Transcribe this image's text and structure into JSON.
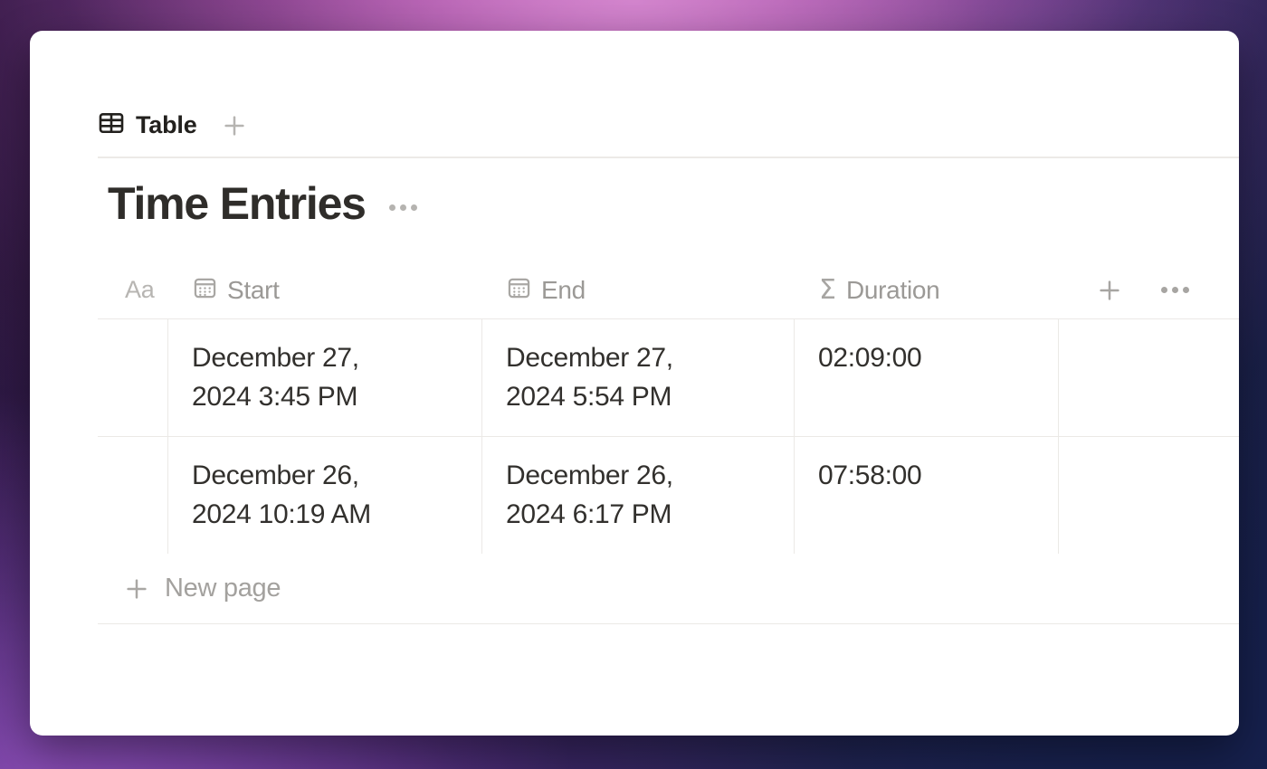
{
  "window": {
    "background_colors": {
      "top_left": "#241335",
      "top_center": "#d56fc0",
      "top_right": "#2a2c63",
      "bottom_left": "#5b2f8f",
      "bottom_right": "#141c3e"
    },
    "card_background": "#ffffff"
  },
  "tabs": {
    "items": [
      {
        "label": "Table",
        "icon": "table-grid-icon",
        "active": true
      }
    ],
    "add_label": "+"
  },
  "page": {
    "title": "Time Entries",
    "more_label": "•••"
  },
  "table": {
    "columns": [
      {
        "key": "title",
        "label": "Aa",
        "icon": "text-type-icon",
        "type": "title"
      },
      {
        "key": "start",
        "label": "Start",
        "icon": "calendar-date-icon",
        "type": "date"
      },
      {
        "key": "end",
        "label": "End",
        "icon": "calendar-date-icon",
        "type": "date"
      },
      {
        "key": "duration",
        "label": "Duration",
        "icon": "sigma-formula-icon",
        "type": "formula"
      }
    ],
    "header_actions": {
      "add_property_label": "+",
      "more_options_label": "•••"
    },
    "rows": [
      {
        "title": "",
        "start_line1": "December 27,",
        "start_line2": "2024 3:45 PM",
        "end_line1": "December 27,",
        "end_line2": "2024 5:54 PM",
        "duration": "02:09:00",
        "extra": ""
      },
      {
        "title": "",
        "start_line1": "December 26,",
        "start_line2": "2024 10:19 AM",
        "end_line1": "December 26,",
        "end_line2": "2024 6:17 PM",
        "duration": "07:58:00",
        "extra": ""
      }
    ],
    "new_row": {
      "label": "New page",
      "icon": "plus-icon"
    }
  }
}
